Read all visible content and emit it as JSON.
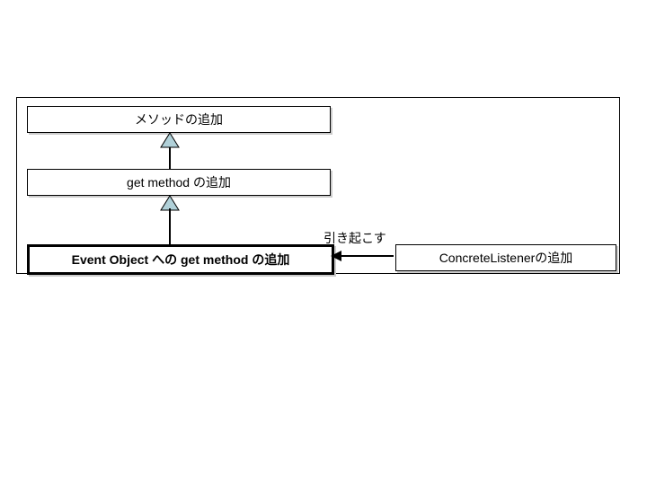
{
  "boxes": {
    "top": "メソッドの追加",
    "middle": "get method の追加",
    "bottom": "Event Object への get method の追加",
    "right": "ConcreteListenerの追加"
  },
  "edge": {
    "label": "引き起こす"
  }
}
